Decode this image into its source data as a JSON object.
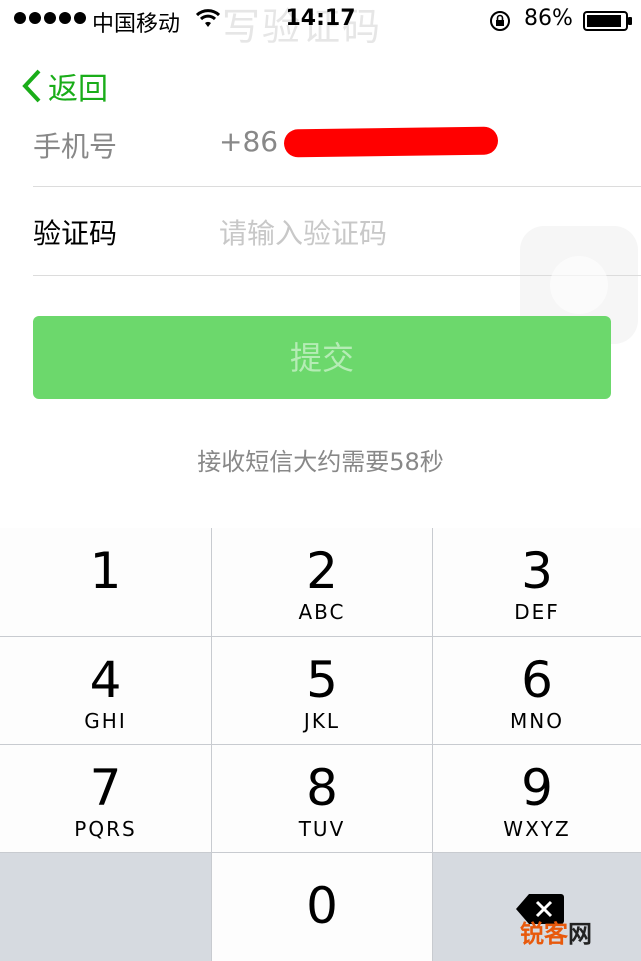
{
  "status_bar": {
    "carrier": "中国移动",
    "time": "14:17",
    "battery": "86%",
    "faded_title": "写验证码"
  },
  "nav": {
    "back_label": "返回"
  },
  "form": {
    "phone_label": "手机号",
    "phone_prefix": "+86",
    "code_label": "验证码",
    "code_placeholder": "请输入验证码"
  },
  "submit_label": "提交",
  "hint": "接收短信大约需要58秒",
  "keypad": {
    "keys": [
      {
        "digit": "1",
        "letters": ""
      },
      {
        "digit": "2",
        "letters": "ABC"
      },
      {
        "digit": "3",
        "letters": "DEF"
      },
      {
        "digit": "4",
        "letters": "GHI"
      },
      {
        "digit": "5",
        "letters": "JKL"
      },
      {
        "digit": "6",
        "letters": "MNO"
      },
      {
        "digit": "7",
        "letters": "PQRS"
      },
      {
        "digit": "8",
        "letters": "TUV"
      },
      {
        "digit": "9",
        "letters": "WXYZ"
      },
      {
        "digit": "0",
        "letters": ""
      }
    ]
  },
  "watermark": {
    "part1": "锐客",
    "part2": "网"
  },
  "colors": {
    "accent": "#1aad19",
    "button": "#6cd86c",
    "redaction": "#ff0000"
  }
}
